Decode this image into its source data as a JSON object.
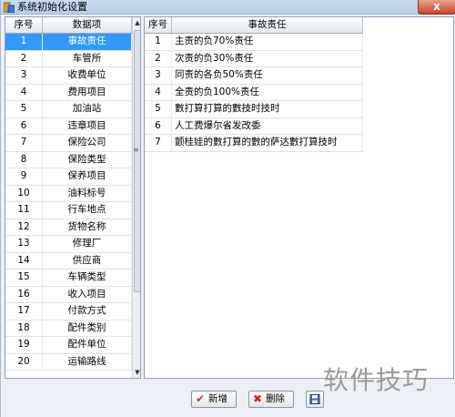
{
  "window": {
    "title": "系统初始化设置",
    "close_label": "x"
  },
  "left_grid": {
    "headers": [
      "序号",
      "数据项"
    ],
    "rows": [
      {
        "no": "1",
        "item": "事故责任"
      },
      {
        "no": "2",
        "item": "车管所"
      },
      {
        "no": "3",
        "item": "收费单位"
      },
      {
        "no": "4",
        "item": "费用项目"
      },
      {
        "no": "5",
        "item": "加油站"
      },
      {
        "no": "6",
        "item": "违章项目"
      },
      {
        "no": "7",
        "item": "保险公司"
      },
      {
        "no": "8",
        "item": "保险类型"
      },
      {
        "no": "9",
        "item": "保养项目"
      },
      {
        "no": "10",
        "item": "油料标号"
      },
      {
        "no": "11",
        "item": "行车地点"
      },
      {
        "no": "12",
        "item": "货物名称"
      },
      {
        "no": "13",
        "item": "修理厂"
      },
      {
        "no": "14",
        "item": "供应商"
      },
      {
        "no": "15",
        "item": "车辆类型"
      },
      {
        "no": "16",
        "item": "收入项目"
      },
      {
        "no": "17",
        "item": "付款方式"
      },
      {
        "no": "18",
        "item": "配件类别"
      },
      {
        "no": "19",
        "item": "配件单位"
      },
      {
        "no": "20",
        "item": "运输路线"
      }
    ],
    "selected_row": "1"
  },
  "right_grid": {
    "headers": [
      "序号",
      "事故责任"
    ],
    "rows": [
      {
        "no": "1",
        "resp": "主责的负70%责任"
      },
      {
        "no": "2",
        "resp": "次责的负30%责任"
      },
      {
        "no": "3",
        "resp": "同责的各负50%责任"
      },
      {
        "no": "4",
        "resp": "全责的负100%责任"
      },
      {
        "no": "5",
        "resp": "數打算打算的數技时技时"
      },
      {
        "no": "6",
        "resp": "人工费爆尔省发改委"
      },
      {
        "no": "7",
        "resp": "颤桂娃的數打算的數的萨达數打算技时"
      }
    ]
  },
  "toolbar": {
    "add_label": "新增",
    "delete_label": "删除",
    "save_icon": "save-icon"
  },
  "watermark": "软件技巧",
  "colors": {
    "selected_row": "#3399ff",
    "window_bg": "#ecf0f7",
    "title_bar": "#c9daf0",
    "close_button": "#c7432a"
  }
}
